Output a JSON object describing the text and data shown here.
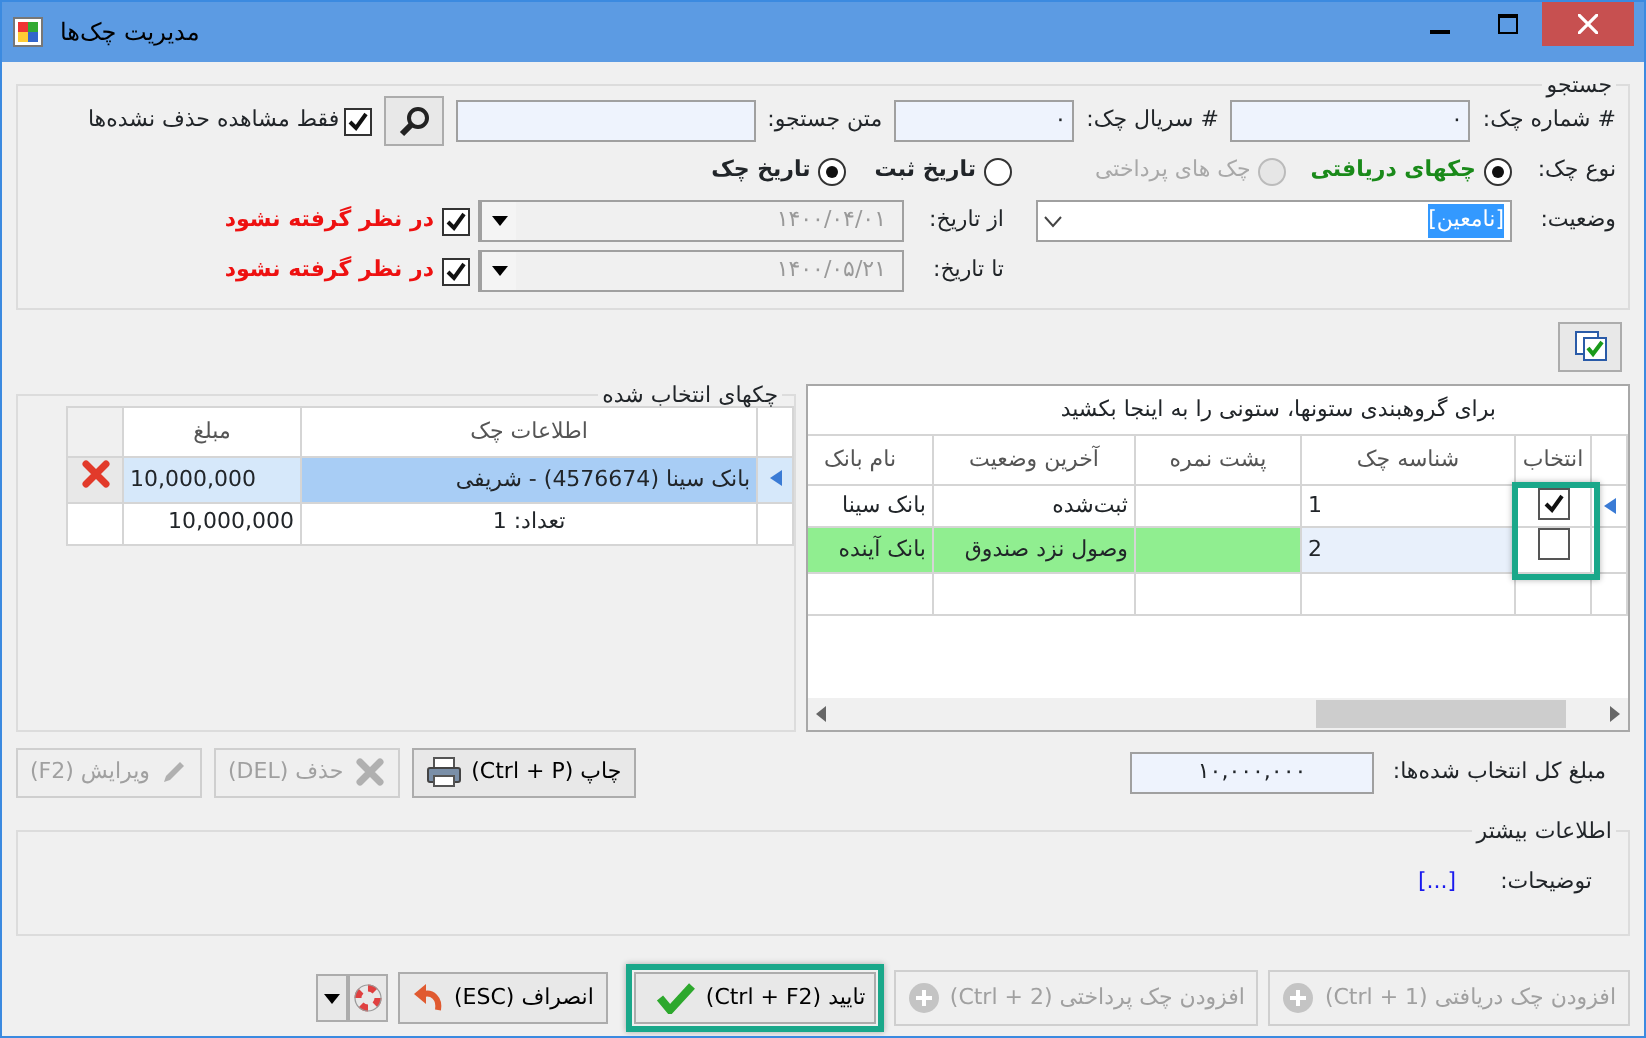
{
  "window": {
    "title": "مدیریت چک‌ها"
  },
  "search": {
    "legend": "جستجو",
    "check_number": {
      "label": "# شماره چک:",
      "value": "٠"
    },
    "serial": {
      "label": "# سریال چک:",
      "value": "٠"
    },
    "text": {
      "label": "متن جستجو:"
    },
    "only_undeleted": {
      "label": "فقط مشاهده حذف نشده‌ها",
      "checked": true
    },
    "check_type": {
      "label": "نوع چک:",
      "options": [
        {
          "label": "چکهای دریافتی",
          "selected": true,
          "disabled": false
        },
        {
          "label": "چک های پرداختی",
          "selected": false,
          "disabled": true
        }
      ]
    },
    "date_type": {
      "options": [
        {
          "label": "تاریخ ثبت",
          "selected": false
        },
        {
          "label": "تاریخ چک",
          "selected": true
        }
      ]
    },
    "status": {
      "label": "وضعیت:",
      "value": "[نامعین]"
    },
    "from_date": {
      "label": "از تاریخ:",
      "value": "۱۴۰۰/۰۴/۰۱",
      "ignore": {
        "label": "در نظر گرفته نشود",
        "checked": true
      }
    },
    "to_date": {
      "label": "تا تاریخ:",
      "value": "۱۴۰۰/۰۵/۲۱",
      "ignore": {
        "label": "در نظر گرفته نشود",
        "checked": true
      }
    }
  },
  "selected_checks": {
    "legend": "چکهای انتخاب شده",
    "columns": [
      "اطلاعات چک",
      "مبلغ"
    ],
    "rows": [
      {
        "info": "بانک سینا (4576674) - شریفی",
        "amount": "10,000,000",
        "selected": true
      }
    ],
    "footer": {
      "info": "تعداد: 1",
      "amount": "10,000,000"
    }
  },
  "checks_grid": {
    "group_hint": "برای گروهبندی ستونها، ستونی را به اینجا بکشید",
    "columns": [
      "انتخاب",
      "شناسه چک",
      "پشت نمره",
      "آخرین وضعیت",
      "نام بانک"
    ],
    "select_column_highlighted": true,
    "rows": [
      {
        "checked": true,
        "current": true,
        "id": "1",
        "status": "ثبت‌شده",
        "bank": "بانک سینا",
        "color": "#ffffff"
      },
      {
        "checked": false,
        "current": false,
        "id": "2",
        "status": "وصول نزد صندوق",
        "bank": "بانک آینده",
        "color": "#90ee90"
      }
    ]
  },
  "total": {
    "label": "مبلغ کل انتخاب شده‌ها:",
    "value": "۱۰,۰۰۰,۰۰۰"
  },
  "actions": [
    {
      "kind": "print",
      "label": "چاپ (Ctrl + P)",
      "disabled": false
    },
    {
      "kind": "delete",
      "label": "حذف (DEL)",
      "disabled": true
    },
    {
      "kind": "edit",
      "label": "ویرایش (F2)",
      "disabled": true
    }
  ],
  "more_info": {
    "legend": "اطلاعات بیشتر",
    "label": "توضیحات:",
    "value": "[...]"
  },
  "footer_buttons": [
    {
      "kind": "add",
      "label": "افزودن چک دریافتی (Ctrl + 1)",
      "disabled": true,
      "highlighted": false
    },
    {
      "kind": "add",
      "label": "افزودن چک پرداختی (Ctrl + 2)",
      "disabled": true,
      "highlighted": false
    },
    {
      "kind": "confirm",
      "label": "تایید (Ctrl + F2)",
      "disabled": false,
      "highlighted": true
    },
    {
      "kind": "cancel",
      "label": "انصراف (ESC)",
      "disabled": false,
      "highlighted": false
    },
    {
      "kind": "help",
      "disabled": false,
      "highlighted": false
    },
    {
      "kind": "menu",
      "disabled": false,
      "highlighted": false
    }
  ]
}
